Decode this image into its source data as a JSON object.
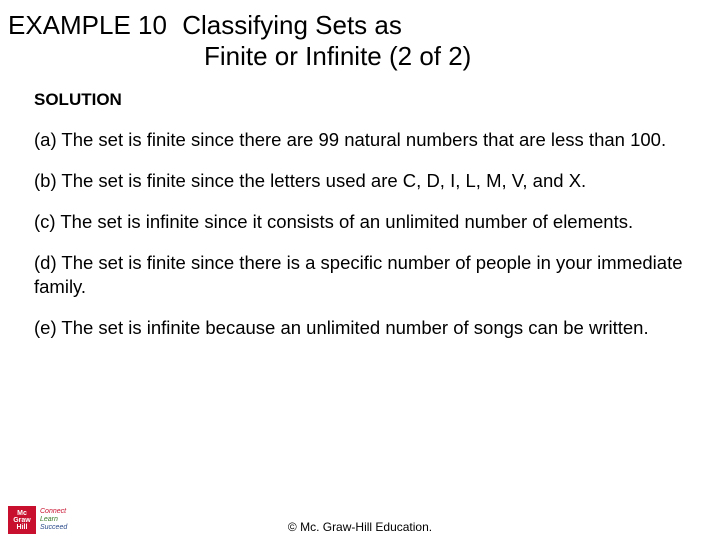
{
  "title": {
    "example_label": "EXAMPLE 10",
    "line1": "Classifying Sets as",
    "line2": "Finite or Infinite (2 of 2)"
  },
  "solution_heading": "SOLUTION",
  "paragraphs": {
    "a": "(a) The set is finite since there are 99 natural numbers that are less than 100.",
    "b": "(b) The set is finite since the letters used are C, D, I, L, M, V, and X.",
    "c": "(c) The set is infinite since it consists of an unlimited number of elements.",
    "d": "(d) The set is finite since there is a specific number of people in your immediate family.",
    "e": "(e) The set is infinite because an unlimited number of songs can be written."
  },
  "logo": {
    "line1": "Mc",
    "line2": "Graw",
    "line3": "Hill",
    "tag1": "Connect",
    "tag2": "Learn",
    "tag3": "Succeed"
  },
  "copyright": "© Mc. Graw-Hill Education."
}
